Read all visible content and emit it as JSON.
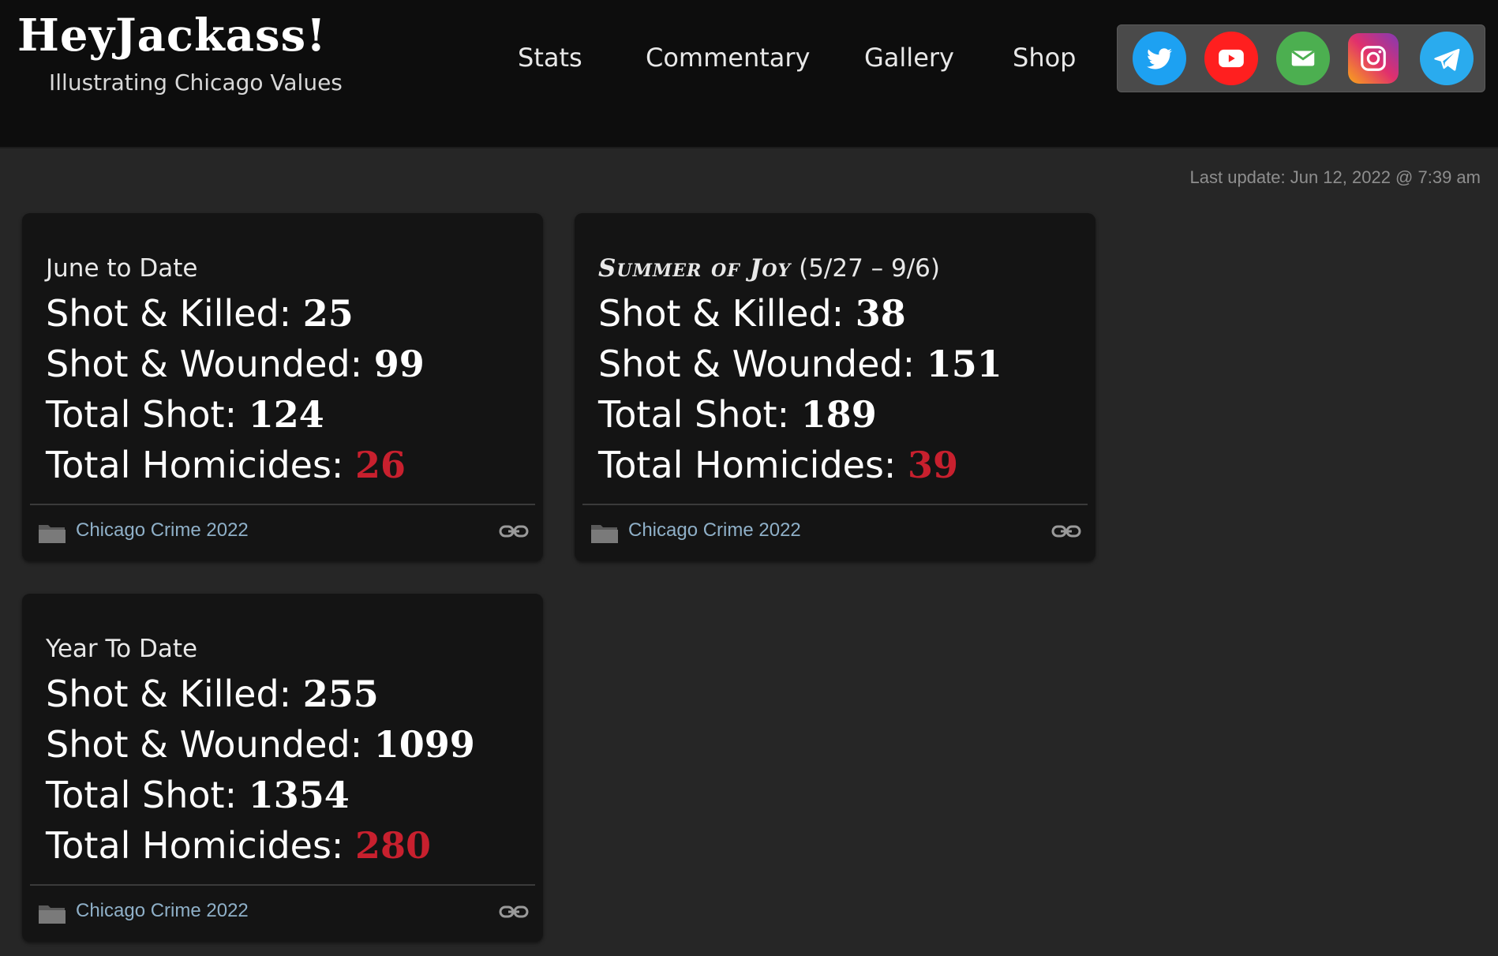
{
  "site": {
    "title": "HeyJackass!",
    "tagline": "Illustrating Chicago Values"
  },
  "nav": {
    "items": [
      {
        "label": "Stats"
      },
      {
        "label": "Commentary"
      },
      {
        "label": "Gallery"
      },
      {
        "label": "Shop"
      }
    ]
  },
  "social": {
    "items": [
      {
        "icon": "twitter-icon",
        "color": "#1da1f2"
      },
      {
        "icon": "youtube-icon",
        "color": "#ff0000"
      },
      {
        "icon": "email-icon",
        "color": "#4caf50"
      },
      {
        "icon": "instagram-icon",
        "color": "#e1306c"
      },
      {
        "icon": "telegram-icon",
        "color": "#2aabee"
      }
    ]
  },
  "last_update": "Last update: Jun 12, 2022 @ 7:39 am",
  "cards": [
    {
      "heading": "June to Date",
      "heading_script": "",
      "stats": [
        {
          "label": "Shot & Killed: ",
          "value": "25"
        },
        {
          "label": "Shot & Wounded: ",
          "value": "99"
        },
        {
          "label": "Total Shot: ",
          "value": "124"
        },
        {
          "label": "Total Homicides: ",
          "value": "26"
        }
      ],
      "category": "Chicago Crime 2022"
    },
    {
      "heading": "(5/27 – 9/6)",
      "heading_script": "Summer of Joy",
      "stats": [
        {
          "label": "Shot & Killed: ",
          "value": "38"
        },
        {
          "label": "Shot & Wounded: ",
          "value": "151"
        },
        {
          "label": "Total Shot: ",
          "value": "189"
        },
        {
          "label": "Total Homicides: ",
          "value": "39"
        }
      ],
      "category": "Chicago Crime 2022"
    },
    {
      "heading": "Year To Date",
      "heading_script": "",
      "stats": [
        {
          "label": "Shot & Killed: ",
          "value": "255"
        },
        {
          "label": "Shot & Wounded: ",
          "value": "1099"
        },
        {
          "label": "Total Shot: ",
          "value": "1354"
        },
        {
          "label": "Total Homicides: ",
          "value": "280"
        }
      ],
      "category": "Chicago Crime 2022"
    }
  ],
  "colors": {
    "accent_red": "#c8202e",
    "link_blue": "#8fb0c8"
  }
}
